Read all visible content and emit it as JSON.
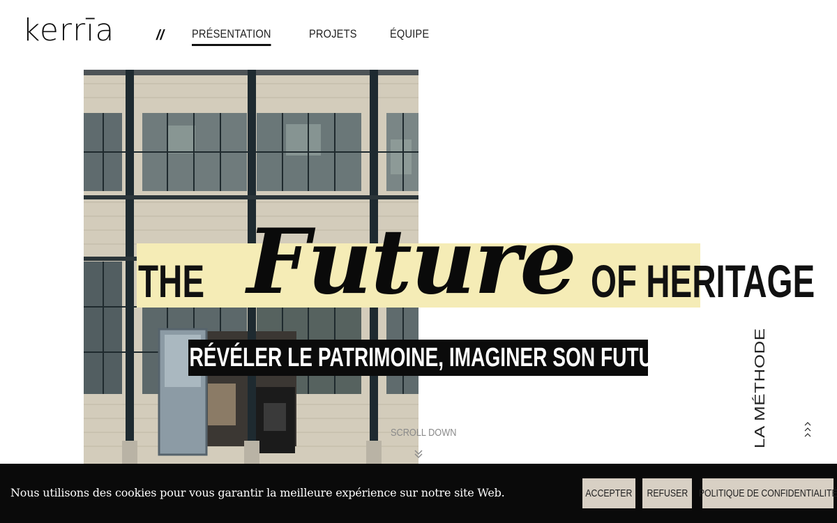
{
  "brand": {
    "logo_text": "kerrīa"
  },
  "header": {
    "separator": "//",
    "nav": [
      {
        "label": "PRÉSENTATION",
        "active": true
      },
      {
        "label": "PROJETS",
        "active": false
      },
      {
        "label": "ÉQUIPE",
        "active": false
      }
    ]
  },
  "hero": {
    "title_pre": "THE",
    "title_main": "Future",
    "title_post": "OF HERITAGE",
    "subtitle": "RÉVÉLER LE PATRIMOINE, IMAGINER SON FUTUR",
    "scroll_label": "SCROLL DOWN",
    "scroll_icon": "double-chevron-down-icon",
    "side_label": "LA MÉTHODE",
    "side_icon": "chevrons-up-icon"
  },
  "cookie": {
    "text": "Nous utilisons des cookies pour vous garantir la meilleure expérience sur notre site Web.",
    "accept": "ACCEPTER",
    "refuse": "REFUSER",
    "policy": "POLITIQUE DE CONFIDENTIALITÉ"
  },
  "colors": {
    "highlight": "#f5ecb6",
    "cookie_bg": "#0a0a0a",
    "button_bg": "#d8d0c4"
  }
}
